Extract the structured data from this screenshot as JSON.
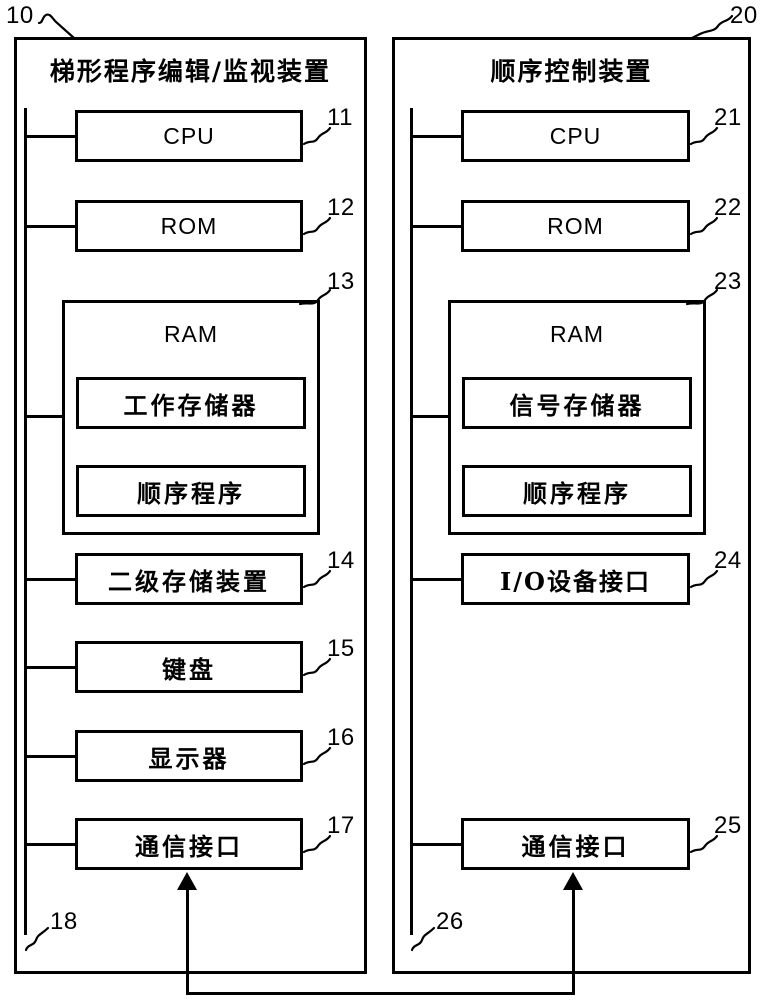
{
  "figure": {
    "devices": [
      {
        "ref": "10",
        "title": "梯形程序编辑/监视装置",
        "bus_ref": "18",
        "components": [
          {
            "ref": "11",
            "label": "CPU",
            "script": "latin"
          },
          {
            "ref": "12",
            "label": "ROM",
            "script": "latin"
          },
          {
            "ref": "13",
            "label": "RAM",
            "script": "latin",
            "children": [
              {
                "label": "工作存储器",
                "script": "cjk"
              },
              {
                "label": "顺序程序",
                "script": "cjk"
              }
            ]
          },
          {
            "ref": "14",
            "label": "二级存储装置",
            "script": "cjk"
          },
          {
            "ref": "15",
            "label": "键盘",
            "script": "cjk"
          },
          {
            "ref": "16",
            "label": "显示器",
            "script": "cjk"
          },
          {
            "ref": "17",
            "label": "通信接口",
            "script": "cjk"
          }
        ]
      },
      {
        "ref": "20",
        "title": "顺序控制装置",
        "bus_ref": "26",
        "components": [
          {
            "ref": "21",
            "label": "CPU",
            "script": "latin"
          },
          {
            "ref": "22",
            "label": "ROM",
            "script": "latin"
          },
          {
            "ref": "23",
            "label": "RAM",
            "script": "latin",
            "children": [
              {
                "label": "信号存储器",
                "script": "cjk"
              },
              {
                "label": "顺序程序",
                "script": "cjk"
              }
            ]
          },
          {
            "ref": "24",
            "label": "I/O设备接口",
            "script": "mono"
          },
          {
            "ref": "25",
            "label": "通信接口",
            "script": "cjk"
          }
        ]
      }
    ],
    "connection": {
      "name": "communication-link",
      "from": "17",
      "to": "25",
      "style": "double-headed-arrow"
    },
    "colors": {
      "stroke": "#000000",
      "background": "#ffffff"
    }
  }
}
